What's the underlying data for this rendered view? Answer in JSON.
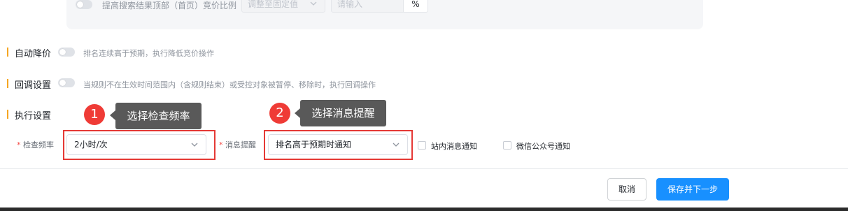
{
  "top_panel": {
    "bid_ratio_label": "提高搜索结果顶部（首页）竞价比例",
    "adjust_select_value": "调整至固定值",
    "ratio_placeholder": "请输入",
    "percent_suffix": "%"
  },
  "sections": {
    "auto_reduce": {
      "title": "自动降价",
      "desc": "排名连续高于预期，执行降低竞价操作"
    },
    "rollback": {
      "title": "回调设置",
      "desc": "当规则不在生效时间范围内（含规则结束）或受控对象被暂停、移除时，执行回调操作"
    },
    "execution": {
      "title": "执行设置"
    }
  },
  "execution_form": {
    "check_frequency_label": "检查频率",
    "check_frequency_value": "2小时/次",
    "message_alert_label": "消息提醒",
    "message_alert_value": "排名高于预期时通知",
    "site_message_label": "站内消息通知",
    "wechat_label": "微信公众号通知"
  },
  "annotations": [
    {
      "number": "1",
      "text": "选择检查频率"
    },
    {
      "number": "2",
      "text": "选择消息提醒"
    }
  ],
  "footer": {
    "cancel_label": "取消",
    "save_next_label": "保存并下一步"
  },
  "colors": {
    "accent_bar": "#f5a623",
    "primary_button": "#1890ff",
    "highlight_box": "#e53935",
    "badge": "#ef3b36",
    "tooltip": "#595959"
  },
  "icons": {
    "chevron": "chevron-down-icon",
    "toggle": "toggle-switch"
  }
}
